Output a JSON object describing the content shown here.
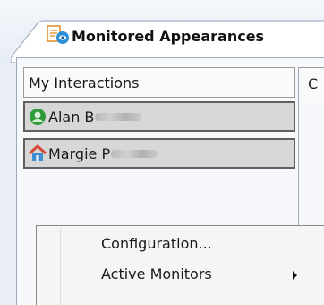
{
  "tab": {
    "label": "Monitored Appearances"
  },
  "list": {
    "header": "My Interactions",
    "users": [
      {
        "first": "Alan B",
        "status": "available"
      },
      {
        "first": "Margie P",
        "status": "at-home"
      }
    ]
  },
  "right_pane": {
    "label_fragment": "C"
  },
  "context_menu": {
    "items": [
      {
        "label": "Configuration..."
      },
      {
        "label": "Active Monitors",
        "has_submenu": true
      }
    ]
  },
  "colors": {
    "window_bg": "#e9eef5",
    "user_row_bg": "#d7d7d7",
    "available_green": "#2f9a3a",
    "home_red": "#d64a3a"
  }
}
